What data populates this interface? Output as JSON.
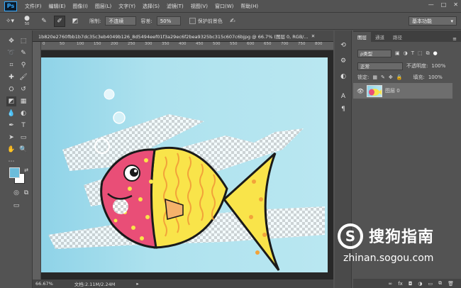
{
  "app": {
    "logo": "Ps"
  },
  "menu": [
    "文件(F)",
    "编辑(E)",
    "图像(I)",
    "图层(L)",
    "文字(Y)",
    "选择(S)",
    "滤镜(T)",
    "视图(V)",
    "窗口(W)",
    "帮助(H)"
  ],
  "window_controls": {
    "minimize": "—",
    "restore": "□",
    "close": "✕"
  },
  "options": {
    "brush_size": "50",
    "limits_label": "限制:",
    "limits_value": "不连续",
    "tolerance_label": "容差:",
    "tolerance_value": "50%",
    "protect_label": "保护前景色",
    "workspace": "基本功能"
  },
  "document": {
    "tab_title": "1b820e2760fbb1b7dc35c3eb4049b126_8d5494eef01f3a29ec6f2bea9325bc315c607c6bjpg @ 66.7% (图层 0, RGB/...",
    "zoom": "66.67%",
    "doc_size": "文档:2.11M/2.24M"
  },
  "ruler": {
    "ticks": [
      "0",
      "50",
      "100",
      "150",
      "200",
      "250",
      "300",
      "350",
      "400",
      "450",
      "500",
      "550",
      "600",
      "650",
      "700",
      "750",
      "800"
    ]
  },
  "layers_panel": {
    "tabs": [
      "图层",
      "通道",
      "路径"
    ],
    "filter_kind": "ρ类型",
    "blend_mode": "正常",
    "opacity_label": "不透明度:",
    "opacity_value": "100%",
    "lock_label": "锁定:",
    "fill_label": "填充:",
    "fill_value": "100%",
    "layer_name": "图层 0",
    "bottom_icons": [
      "∞",
      "fx",
      "◘",
      "◑",
      "▭",
      "⧉",
      "🗑"
    ]
  },
  "watermark": {
    "brand": "搜狗指南",
    "url": "zhinan.sogou.com",
    "logo": "S"
  },
  "colors": {
    "foreground": "#6bbcda",
    "background": "#ffffff",
    "fish_head": "#e94e77",
    "fish_body": "#f9e44a"
  }
}
